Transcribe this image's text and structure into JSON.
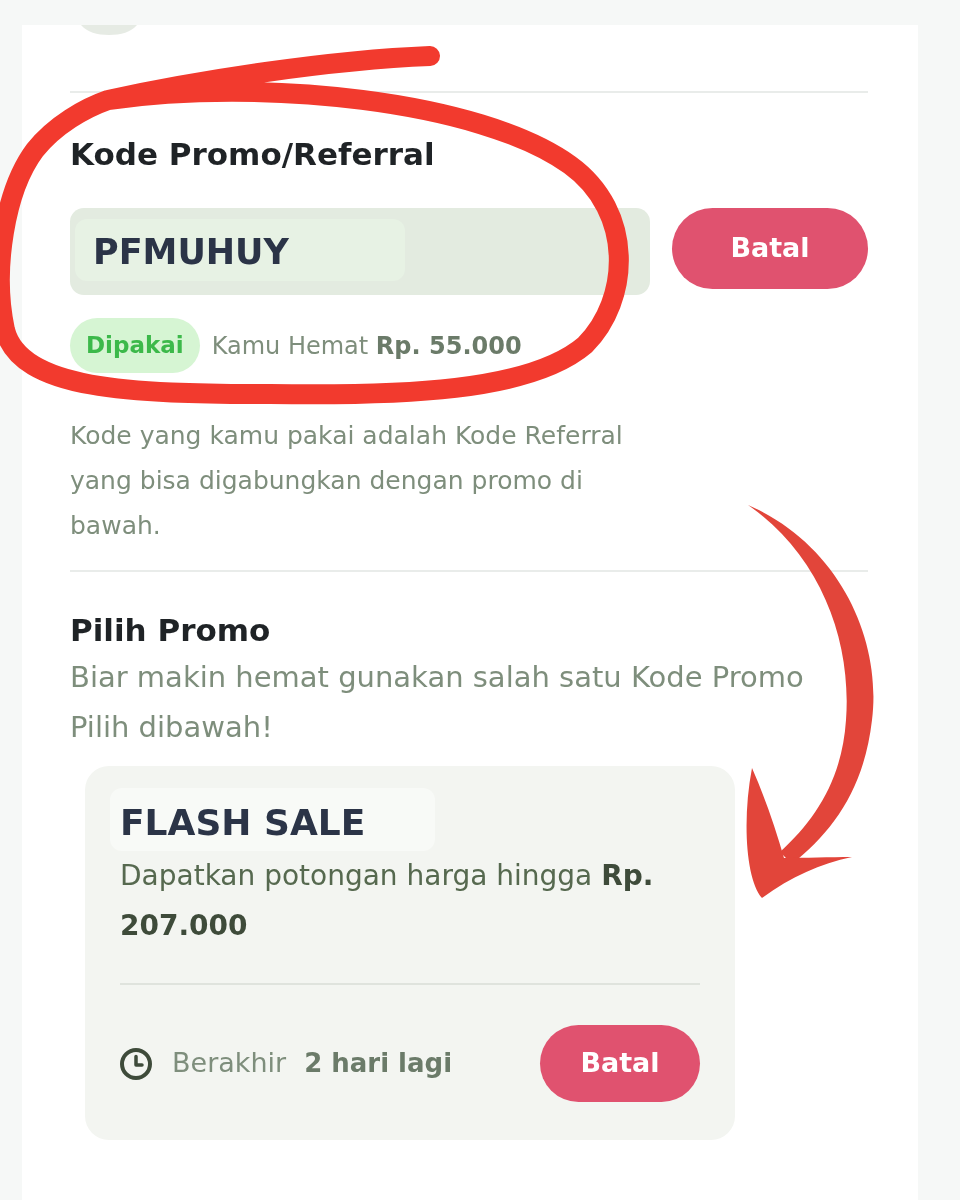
{
  "referral": {
    "title": "Kode Promo/Referral",
    "code_field": {
      "value": "PFMUHUY"
    },
    "cancel_button": "Batal",
    "status_badge": "Dipakai",
    "savings": "Kamu Hemat **Rp. 55.000**",
    "note": "Kode yang kamu pakai adalah Kode Referral yang bisa digabungkan dengan promo di bawah."
  },
  "promo_section": {
    "title": "Pilih Promo",
    "subtitle": "Biar makin hemat gunakan salah satu Kode Promo Pilih dibawah!",
    "promos": [
      {
        "title": "FLASH SALE",
        "description": "Dapatkan potongan harga hingga **Rp. 207.000**",
        "expiry_label": "Berakhir",
        "expiry_value": "2 hari lagi",
        "button": "Batal"
      }
    ]
  }
}
